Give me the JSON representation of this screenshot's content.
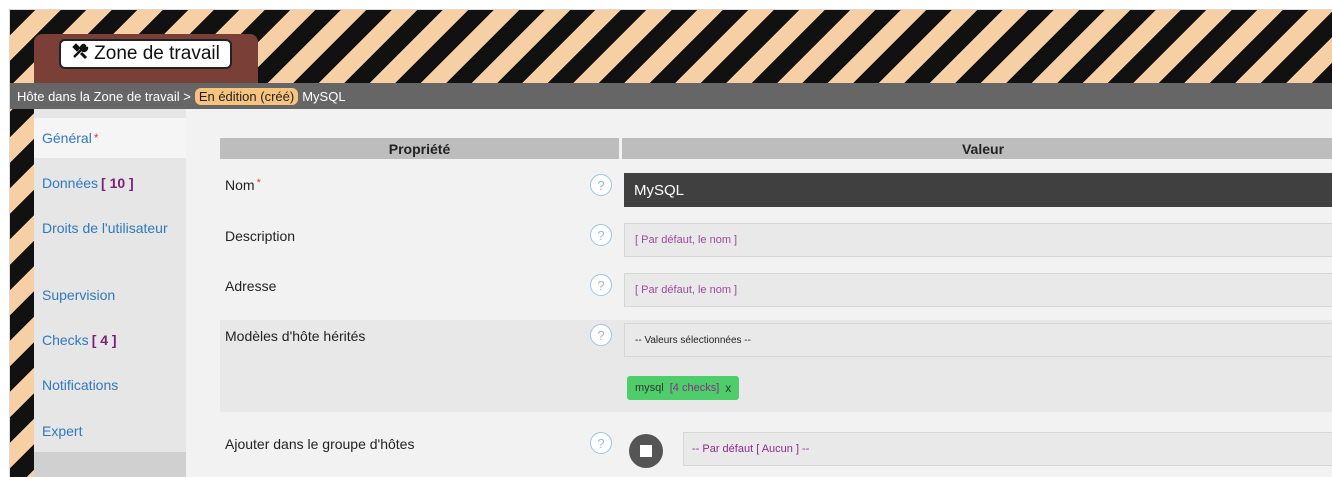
{
  "zone_button": {
    "label": "Zone de travail",
    "icon": "tools-icon"
  },
  "breadcrumb": {
    "prefix": "Hôte dans la Zone de travail >",
    "status_badge": "En édition (créé)",
    "host": "MySQL"
  },
  "sidebar": {
    "general": {
      "label": "Général",
      "required_mark": "*"
    },
    "donnees": {
      "label": "Données",
      "count": "[ 10 ]"
    },
    "droits": {
      "label": "Droits de l'utilisateur"
    },
    "supervision": {
      "label": "Supervision"
    },
    "checks": {
      "label": "Checks",
      "count": "[ 4 ]"
    },
    "notifications": {
      "label": "Notifications"
    },
    "expert": {
      "label": "Expert"
    }
  },
  "table": {
    "header_property": "Propriété",
    "header_value": "Valeur",
    "help_symbol": "?",
    "rows": {
      "nom": {
        "label": "Nom",
        "required_mark": "*",
        "value": "MySQL"
      },
      "description": {
        "label": "Description",
        "placeholder": "[ Par défaut, le nom ]"
      },
      "adresse": {
        "label": "Adresse",
        "placeholder": "[ Par défaut, le nom ]"
      },
      "modeles": {
        "label": "Modèles d'hôte hérités",
        "select_text": "-- Valeurs sélectionnées --",
        "chip_name": "mysql",
        "chip_count": "[4 checks]",
        "chip_remove": "x"
      },
      "groupe": {
        "label": "Ajouter dans le groupe d'hôtes",
        "select_text": "-- Par défaut [ Aucun ] --"
      }
    }
  },
  "colors": {
    "stripe_dark": "#111111",
    "stripe_light": "#f7cfa4",
    "link": "#2f78bd",
    "required": "#e23b3b",
    "count": "#7a2079",
    "chip": "#4ece6a"
  }
}
